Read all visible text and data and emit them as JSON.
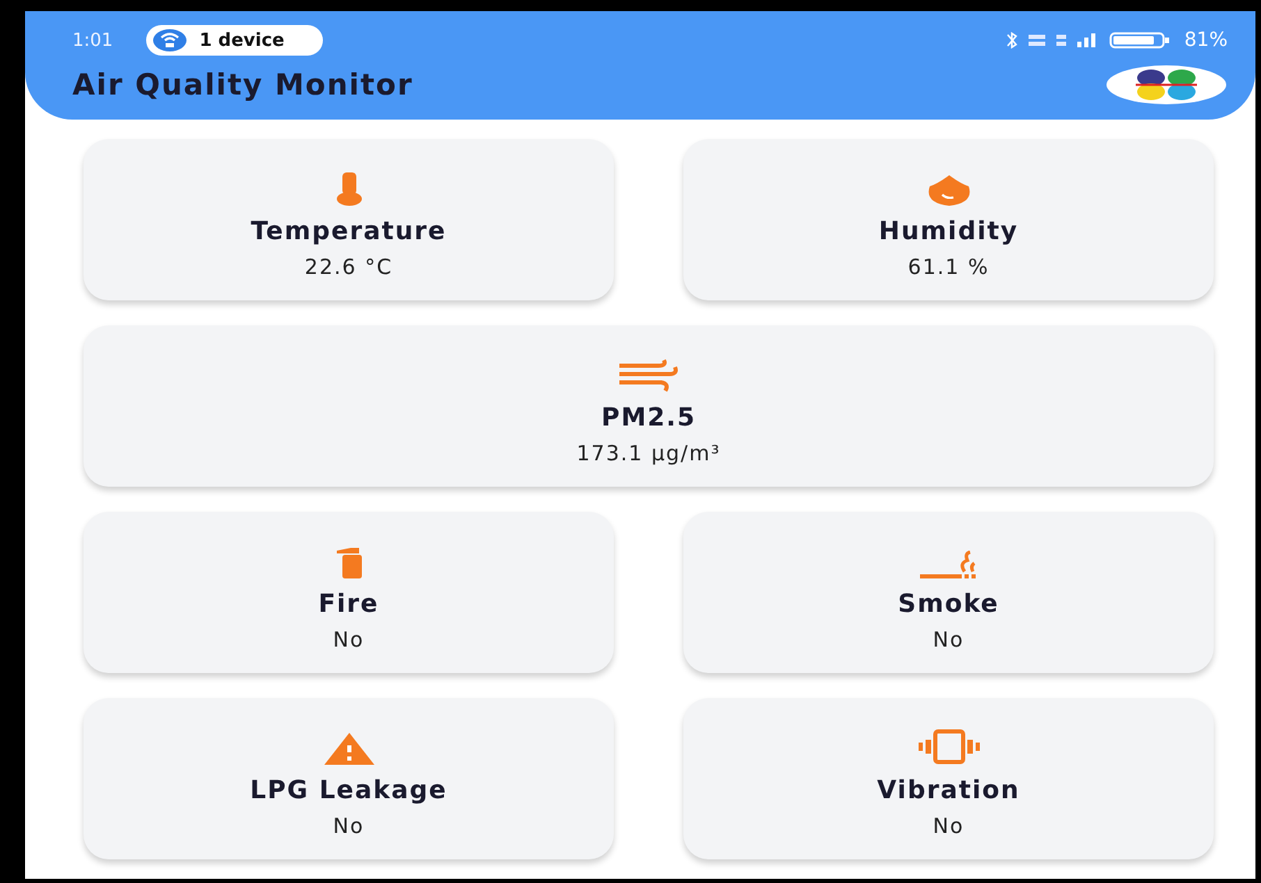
{
  "status_bar": {
    "time": "1:01",
    "device_pill": "1 device",
    "battery": "81%"
  },
  "header": {
    "title": "Air Quality Monitor"
  },
  "cards": [
    {
      "kind": "thermometer",
      "label": "Temperature",
      "value": "22.6 °C"
    },
    {
      "kind": "drop",
      "label": "Humidity",
      "value": "61.1 %"
    },
    {
      "kind": "wind",
      "label": "PM2.5",
      "value": "173.1 µg/m³"
    },
    {
      "kind": "extinguisher",
      "label": "Fire",
      "value": "No"
    },
    {
      "kind": "smoke",
      "label": "Smoke",
      "value": "No"
    },
    {
      "kind": "warning",
      "label": "LPG Leakage",
      "value": "No"
    },
    {
      "kind": "vibration",
      "label": "Vibration",
      "value": "No"
    }
  ]
}
